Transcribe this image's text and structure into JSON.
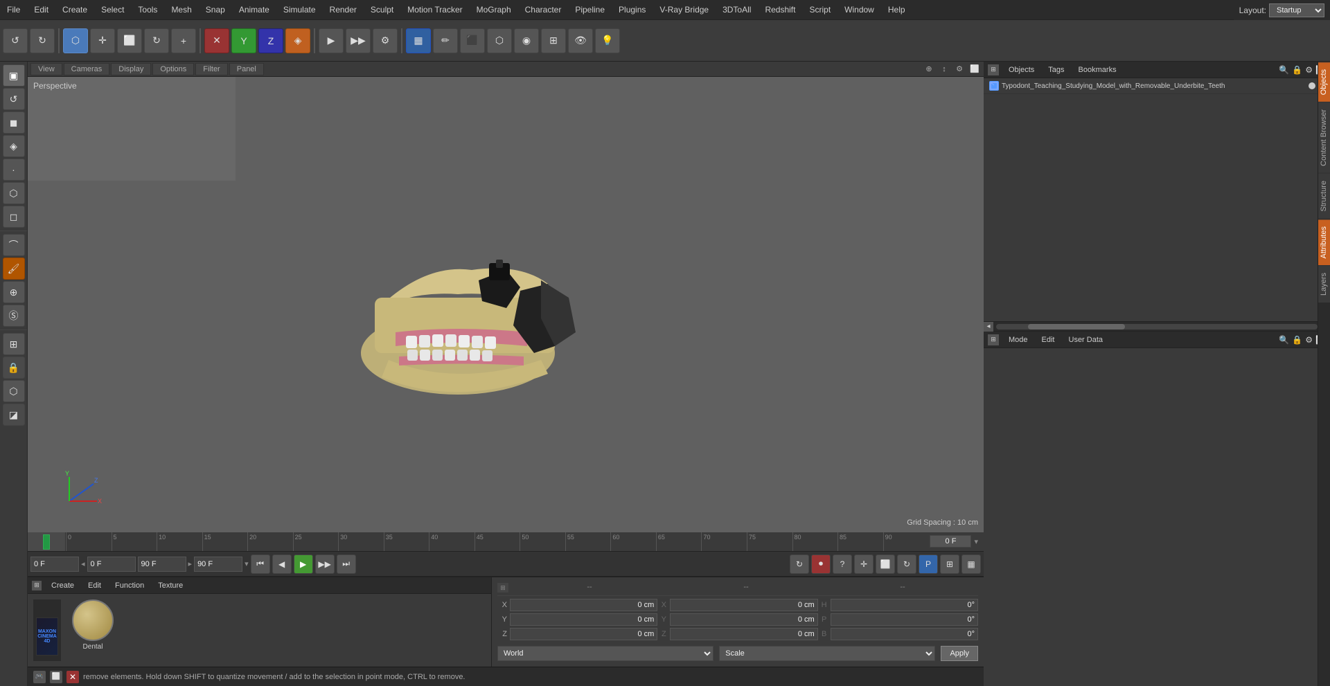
{
  "menu": {
    "items": [
      "File",
      "Edit",
      "Create",
      "Select",
      "Tools",
      "Mesh",
      "Snap",
      "Animate",
      "Simulate",
      "Render",
      "Sculpt",
      "Motion Tracker",
      "MoGraph",
      "Character",
      "Pipeline",
      "Plugins",
      "V-Ray Bridge",
      "3DToAll",
      "Redshift",
      "Script",
      "Window",
      "Help"
    ]
  },
  "layout": {
    "label": "Layout:",
    "value": "Startup"
  },
  "viewport": {
    "label": "Perspective",
    "tabs": [
      "View",
      "Cameras",
      "Display",
      "Options",
      "Filter",
      "Panel"
    ],
    "grid_spacing": "Grid Spacing : 10 cm"
  },
  "object": {
    "name": "Typodont_Teaching_Studying_Model_with_Removable_Underbite_Teeth"
  },
  "timeline": {
    "frame_start": "0",
    "frame_end": "90 F",
    "current_frame": "0 F",
    "frame_label": "0 F",
    "ruler_marks": [
      "0",
      "5",
      "10",
      "15",
      "20",
      "25",
      "30",
      "35",
      "40",
      "45",
      "50",
      "55",
      "60",
      "65",
      "70",
      "75",
      "80",
      "85",
      "90"
    ],
    "current_f_display": "0 F"
  },
  "material": {
    "menu_items": [
      "Create",
      "Edit",
      "Function",
      "Texture"
    ],
    "name": "Dental"
  },
  "coordinates": {
    "header": [
      "--",
      "--",
      "--"
    ],
    "x_pos": "0 cm",
    "y_pos": "0 cm",
    "z_pos": "0 cm",
    "x_size": "0 cm",
    "y_size": "0 cm",
    "z_size": "0 cm",
    "h_rot": "0°",
    "p_rot": "0°",
    "b_rot": "0°",
    "world_label": "World",
    "scale_label": "Scale",
    "apply_label": "Apply"
  },
  "status": {
    "message": "remove elements. Hold down SHIFT to quantize movement / add to the selection in point mode, CTRL to remove."
  },
  "right_panel": {
    "obj_menu": [
      "Objects",
      "Tags",
      "Bookmarks"
    ],
    "attr_menu": [
      "Mode",
      "Edit",
      "User Data"
    ],
    "vtabs": [
      "Objects",
      "Content Browser",
      "Structure",
      "Attributes",
      "Layers"
    ]
  }
}
